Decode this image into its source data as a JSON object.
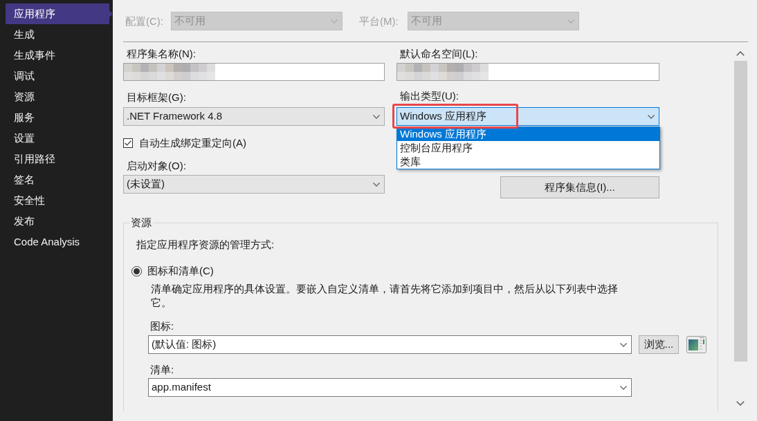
{
  "sidebar": {
    "items": [
      {
        "label": "应用程序",
        "selected": true
      },
      {
        "label": "生成",
        "selected": false
      },
      {
        "label": "生成事件",
        "selected": false
      },
      {
        "label": "调试",
        "selected": false
      },
      {
        "label": "资源",
        "selected": false
      },
      {
        "label": "服务",
        "selected": false
      },
      {
        "label": "设置",
        "selected": false
      },
      {
        "label": "引用路径",
        "selected": false
      },
      {
        "label": "签名",
        "selected": false
      },
      {
        "label": "安全性",
        "selected": false
      },
      {
        "label": "发布",
        "selected": false
      },
      {
        "label": "Code Analysis",
        "selected": false
      }
    ]
  },
  "toolbar": {
    "fields": [
      {
        "label": "配置(C):",
        "value": "不可用",
        "disabled": true
      },
      {
        "label": "平台(M):",
        "value": "不可用",
        "disabled": true
      }
    ]
  },
  "application": {
    "assembly_name": {
      "label": "程序集名称(N):",
      "redacted": true
    },
    "target_framework": {
      "label": "目标框架(G):",
      "value": ".NET Framework 4.8"
    },
    "auto_binding_redirects": {
      "label": "自动生成绑定重定向(A)",
      "checked": true
    },
    "startup_object": {
      "label": "启动对象(O):",
      "value": "(未设置)"
    },
    "default_namespace": {
      "label": "默认命名空间(L):",
      "redacted": true
    },
    "output_type": {
      "label": "输出类型(U):",
      "value": "Windows 应用程序",
      "expanded": true,
      "highlighted": true,
      "options": [
        {
          "label": "Windows 应用程序",
          "selected": true
        },
        {
          "label": "控制台应用程序",
          "selected": false
        },
        {
          "label": "类库",
          "selected": false
        }
      ]
    },
    "assembly_info_button": {
      "label": "程序集信息(I)..."
    }
  },
  "resources": {
    "title": "资源",
    "prompt": "指定应用程序资源的管理方式:",
    "options": [
      {
        "label": "图标和清单(C)",
        "selected": true,
        "note": "清单确定应用程序的具体设置。要嵌入自定义清单，请首先将它添加到项目中，然后从以下列表中选择它。",
        "icon": {
          "label": "图标:",
          "value": "(默认值: 图标)",
          "browse_button": "浏览..."
        },
        "manifest": {
          "label": "清单:",
          "value": "app.manifest"
        }
      }
    ]
  }
}
